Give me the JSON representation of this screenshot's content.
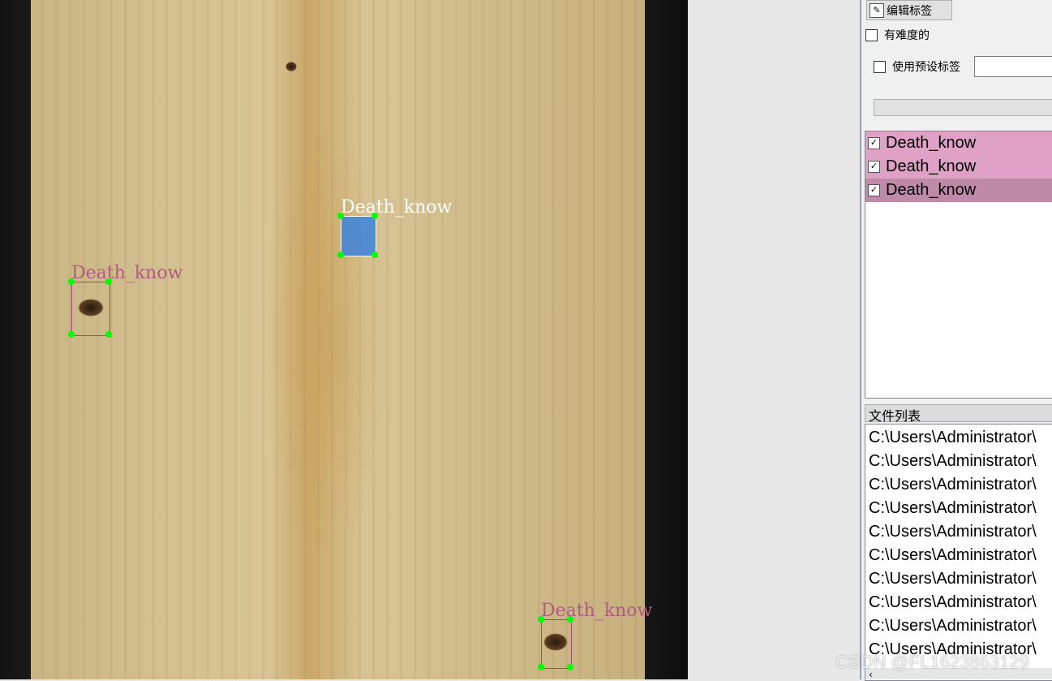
{
  "canvas": {
    "shapes": [
      {
        "label": "Death_know",
        "selected": true
      },
      {
        "label": "Death_know",
        "selected": false
      },
      {
        "label": "Death_know",
        "selected": false
      }
    ]
  },
  "panel": {
    "edit_label_button": "编辑标签",
    "difficult_checkbox": {
      "label": "有难度的",
      "checked": false
    },
    "use_default_label": {
      "label": "使用预设标签",
      "checked": false,
      "value": ""
    },
    "label_list": [
      {
        "label": "Death_know",
        "checked": true
      },
      {
        "label": "Death_know",
        "checked": true
      },
      {
        "label": "Death_know",
        "checked": true,
        "selected": true
      }
    ],
    "file_list_title": "文件列表",
    "file_list": [
      "C:\\Users\\Administrator\\",
      "C:\\Users\\Administrator\\",
      "C:\\Users\\Administrator\\",
      "C:\\Users\\Administrator\\",
      "C:\\Users\\Administrator\\",
      "C:\\Users\\Administrator\\",
      "C:\\Users\\Administrator\\",
      "C:\\Users\\Administrator\\",
      "C:\\Users\\Administrator\\",
      "C:\\Users\\Administrator\\"
    ]
  },
  "colors": {
    "label_bg": "#dfa2c6",
    "label_selected_bg": "#be8aa8",
    "box_color": "#a04870",
    "selected_fill": "#3c82dc",
    "vertex": "#00ff00"
  },
  "watermark": "CSDN @FL1623863129"
}
